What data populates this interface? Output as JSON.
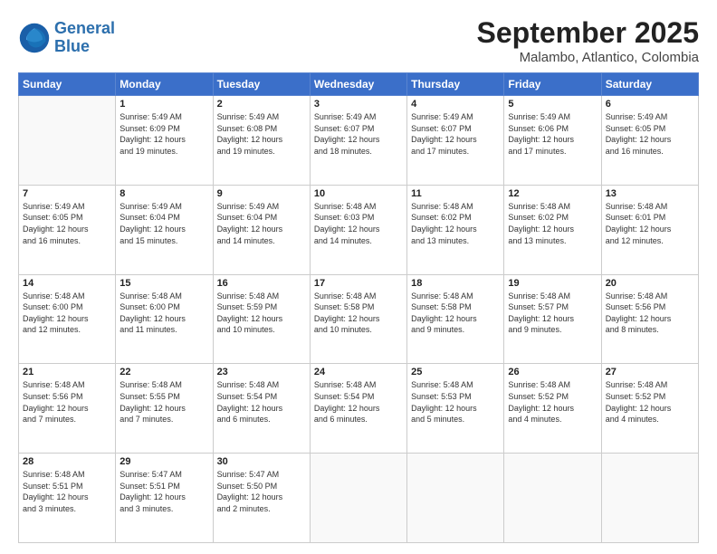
{
  "logo": {
    "line1": "General",
    "line2": "Blue"
  },
  "title": "September 2025",
  "subtitle": "Malambo, Atlantico, Colombia",
  "days_of_week": [
    "Sunday",
    "Monday",
    "Tuesday",
    "Wednesday",
    "Thursday",
    "Friday",
    "Saturday"
  ],
  "weeks": [
    [
      {
        "day": "",
        "content": ""
      },
      {
        "day": "1",
        "content": "Sunrise: 5:49 AM\nSunset: 6:09 PM\nDaylight: 12 hours\nand 19 minutes."
      },
      {
        "day": "2",
        "content": "Sunrise: 5:49 AM\nSunset: 6:08 PM\nDaylight: 12 hours\nand 19 minutes."
      },
      {
        "day": "3",
        "content": "Sunrise: 5:49 AM\nSunset: 6:07 PM\nDaylight: 12 hours\nand 18 minutes."
      },
      {
        "day": "4",
        "content": "Sunrise: 5:49 AM\nSunset: 6:07 PM\nDaylight: 12 hours\nand 17 minutes."
      },
      {
        "day": "5",
        "content": "Sunrise: 5:49 AM\nSunset: 6:06 PM\nDaylight: 12 hours\nand 17 minutes."
      },
      {
        "day": "6",
        "content": "Sunrise: 5:49 AM\nSunset: 6:05 PM\nDaylight: 12 hours\nand 16 minutes."
      }
    ],
    [
      {
        "day": "7",
        "content": "Sunrise: 5:49 AM\nSunset: 6:05 PM\nDaylight: 12 hours\nand 16 minutes."
      },
      {
        "day": "8",
        "content": "Sunrise: 5:49 AM\nSunset: 6:04 PM\nDaylight: 12 hours\nand 15 minutes."
      },
      {
        "day": "9",
        "content": "Sunrise: 5:49 AM\nSunset: 6:04 PM\nDaylight: 12 hours\nand 14 minutes."
      },
      {
        "day": "10",
        "content": "Sunrise: 5:48 AM\nSunset: 6:03 PM\nDaylight: 12 hours\nand 14 minutes."
      },
      {
        "day": "11",
        "content": "Sunrise: 5:48 AM\nSunset: 6:02 PM\nDaylight: 12 hours\nand 13 minutes."
      },
      {
        "day": "12",
        "content": "Sunrise: 5:48 AM\nSunset: 6:02 PM\nDaylight: 12 hours\nand 13 minutes."
      },
      {
        "day": "13",
        "content": "Sunrise: 5:48 AM\nSunset: 6:01 PM\nDaylight: 12 hours\nand 12 minutes."
      }
    ],
    [
      {
        "day": "14",
        "content": "Sunrise: 5:48 AM\nSunset: 6:00 PM\nDaylight: 12 hours\nand 12 minutes."
      },
      {
        "day": "15",
        "content": "Sunrise: 5:48 AM\nSunset: 6:00 PM\nDaylight: 12 hours\nand 11 minutes."
      },
      {
        "day": "16",
        "content": "Sunrise: 5:48 AM\nSunset: 5:59 PM\nDaylight: 12 hours\nand 10 minutes."
      },
      {
        "day": "17",
        "content": "Sunrise: 5:48 AM\nSunset: 5:58 PM\nDaylight: 12 hours\nand 10 minutes."
      },
      {
        "day": "18",
        "content": "Sunrise: 5:48 AM\nSunset: 5:58 PM\nDaylight: 12 hours\nand 9 minutes."
      },
      {
        "day": "19",
        "content": "Sunrise: 5:48 AM\nSunset: 5:57 PM\nDaylight: 12 hours\nand 9 minutes."
      },
      {
        "day": "20",
        "content": "Sunrise: 5:48 AM\nSunset: 5:56 PM\nDaylight: 12 hours\nand 8 minutes."
      }
    ],
    [
      {
        "day": "21",
        "content": "Sunrise: 5:48 AM\nSunset: 5:56 PM\nDaylight: 12 hours\nand 7 minutes."
      },
      {
        "day": "22",
        "content": "Sunrise: 5:48 AM\nSunset: 5:55 PM\nDaylight: 12 hours\nand 7 minutes."
      },
      {
        "day": "23",
        "content": "Sunrise: 5:48 AM\nSunset: 5:54 PM\nDaylight: 12 hours\nand 6 minutes."
      },
      {
        "day": "24",
        "content": "Sunrise: 5:48 AM\nSunset: 5:54 PM\nDaylight: 12 hours\nand 6 minutes."
      },
      {
        "day": "25",
        "content": "Sunrise: 5:48 AM\nSunset: 5:53 PM\nDaylight: 12 hours\nand 5 minutes."
      },
      {
        "day": "26",
        "content": "Sunrise: 5:48 AM\nSunset: 5:52 PM\nDaylight: 12 hours\nand 4 minutes."
      },
      {
        "day": "27",
        "content": "Sunrise: 5:48 AM\nSunset: 5:52 PM\nDaylight: 12 hours\nand 4 minutes."
      }
    ],
    [
      {
        "day": "28",
        "content": "Sunrise: 5:48 AM\nSunset: 5:51 PM\nDaylight: 12 hours\nand 3 minutes."
      },
      {
        "day": "29",
        "content": "Sunrise: 5:47 AM\nSunset: 5:51 PM\nDaylight: 12 hours\nand 3 minutes."
      },
      {
        "day": "30",
        "content": "Sunrise: 5:47 AM\nSunset: 5:50 PM\nDaylight: 12 hours\nand 2 minutes."
      },
      {
        "day": "",
        "content": ""
      },
      {
        "day": "",
        "content": ""
      },
      {
        "day": "",
        "content": ""
      },
      {
        "day": "",
        "content": ""
      }
    ]
  ]
}
